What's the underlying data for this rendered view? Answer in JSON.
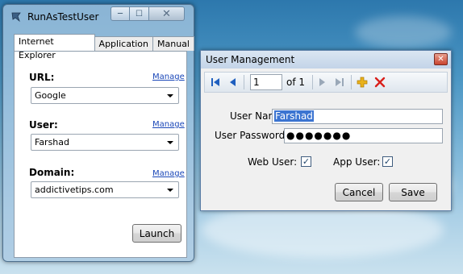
{
  "main_window": {
    "title": "RunAsTestUser",
    "controls": {
      "minimize": "─",
      "maximize": "☐",
      "close": "✕"
    },
    "tabs": [
      {
        "label": "Internet Explorer"
      },
      {
        "label": "Application"
      },
      {
        "label": "Manual"
      }
    ],
    "url": {
      "label": "URL:",
      "manage": "Manage",
      "value": "Google"
    },
    "user": {
      "label": "User:",
      "manage": "Manage",
      "value": "Farshad"
    },
    "domain": {
      "label": "Domain:",
      "manage": "Manage",
      "value": "addictivetips.com"
    },
    "launch_label": "Launch"
  },
  "user_window": {
    "title": "User Management",
    "close_glyph": "✕",
    "nav": {
      "position": "1",
      "of_label": "of 1"
    },
    "user_name": {
      "label": "User Name:",
      "value": "Farshad"
    },
    "password": {
      "label": "User Password:",
      "value": "●●●●●●●"
    },
    "web_user": {
      "label": "Web User:",
      "glyph": "✓"
    },
    "app_user": {
      "label": "App User:",
      "glyph": "✓"
    },
    "cancel_label": "Cancel",
    "save_label": "Save"
  },
  "colors": {
    "link": "#1a47b8",
    "selection": "#3b74d1",
    "add_icon": "#e9b21b",
    "delete_icon": "#d9201b",
    "nav_active": "#1f5fbf"
  }
}
